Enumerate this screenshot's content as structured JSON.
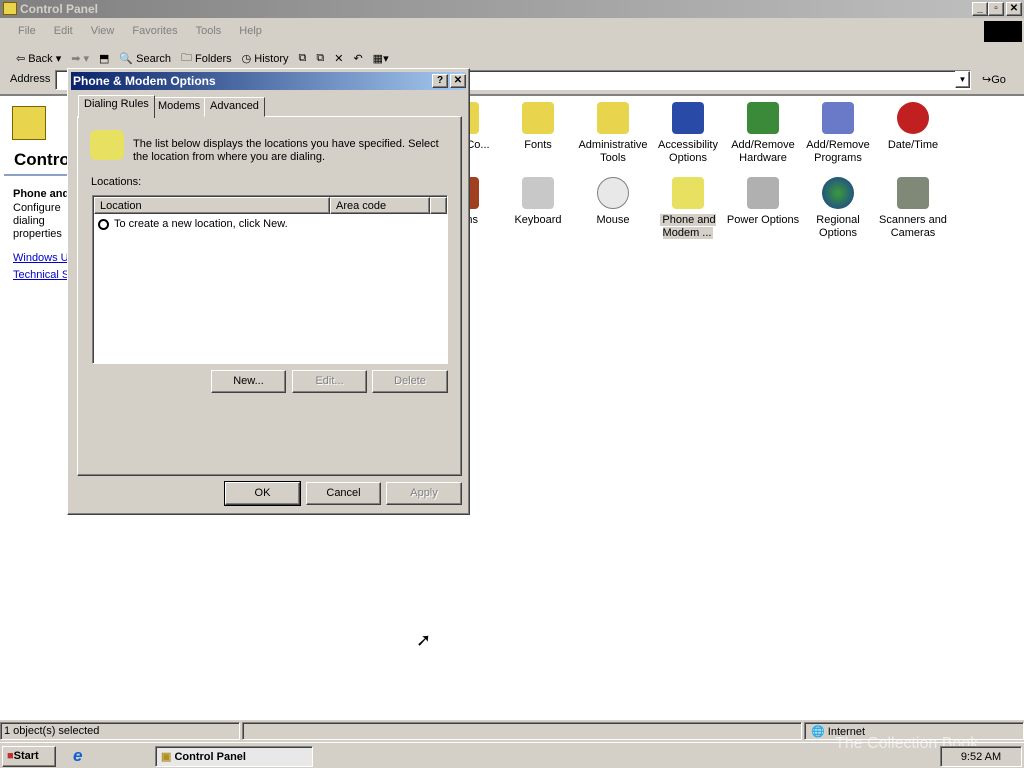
{
  "window": {
    "title": "Control Panel"
  },
  "menu": [
    "File",
    "Edit",
    "View",
    "Favorites",
    "Tools",
    "Help"
  ],
  "toolbar": {
    "back": "Back",
    "search": "Search",
    "folders": "Folders",
    "history": "History"
  },
  "address": {
    "label": "Address",
    "go": "Go"
  },
  "left_pane": {
    "title": "Control Panel",
    "item_title": "Phone and Modem Options",
    "item_desc": "Configure dialing properties",
    "links": [
      "Windows Update",
      "Technical Support"
    ]
  },
  "icons": [
    {
      "label": "Folder Options / Network and Dial-up Co...",
      "visible": "k and Co..."
    },
    {
      "label": "Fonts"
    },
    {
      "label": "Administrative Tools"
    },
    {
      "label": "Accessibility Options"
    },
    {
      "label": "Add/Remove Hardware"
    },
    {
      "label": "Add/Remove Programs"
    },
    {
      "label": "Date/Time"
    },
    {
      "visible": "net ns"
    },
    {
      "label": "Keyboard"
    },
    {
      "label": "Mouse"
    },
    {
      "label": "Phone and Modem ...",
      "selected": true
    },
    {
      "label": "Power Options"
    },
    {
      "label": "Regional Options"
    },
    {
      "label": "Scanners and Cameras"
    }
  ],
  "dialog": {
    "title": "Phone & Modem Options",
    "tabs": [
      "Dialing Rules",
      "Modems",
      "Advanced"
    ],
    "active_tab": "Dialing Rules",
    "description": "The list below displays the locations you have specified. Select the location from where you are dialing.",
    "locations_label": "Locations:",
    "columns": [
      "Location",
      "Area code"
    ],
    "rows": [
      "To create a new location, click New."
    ],
    "new": "New...",
    "edit": "Edit...",
    "delete": "Delete",
    "ok": "OK",
    "cancel": "Cancel",
    "apply": "Apply"
  },
  "status": {
    "selected": "1 object(s) selected",
    "zone": "Internet"
  },
  "taskbar": {
    "start": "Start",
    "task": "Control Panel",
    "clock": "9:52 AM"
  },
  "watermark": "The Collection Book"
}
